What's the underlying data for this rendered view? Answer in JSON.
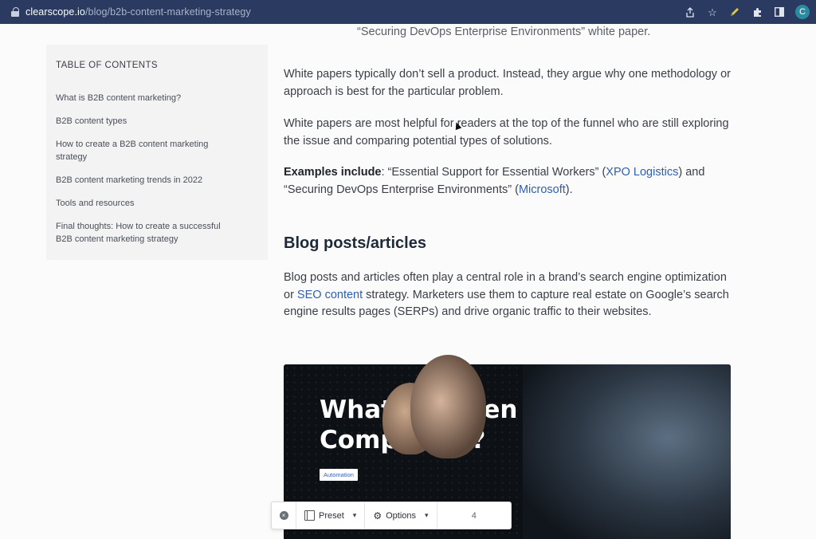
{
  "browser": {
    "url_host": "clearscope.io",
    "url_path": "/blog/b2b-content-marketing-strategy",
    "avatar_letter": "C"
  },
  "toc": {
    "title": "TABLE OF CONTENTS",
    "items": [
      "What is B2B content marketing?",
      "B2B content types",
      "How to create a B2B content marketing strategy",
      "B2B content marketing trends in 2022",
      "Tools and resources",
      "Final thoughts: How to create a successful B2B content marketing strategy"
    ]
  },
  "article": {
    "top_line": "“Securing DevOps Enterprise Environments” white paper.",
    "p1": "White papers typically don’t sell a product. Instead, they argue why one methodology or approach is best for the particular problem.",
    "p2": "White papers are most helpful for readers at the top of the funnel who are still exploring the issue and comparing potential types of solutions.",
    "p3": {
      "bold": "Examples include",
      "t1": ": “Essential Support for Essential Workers” (",
      "link1": "XPO Logistics",
      "t2": ") and “Securing DevOps Enterprise Environments” (",
      "link2": "Microsoft",
      "t3": ")."
    },
    "heading": "Blog posts/articles",
    "p4": {
      "t1": "Blog posts and articles often play a central role in a brand’s search engine optimization or ",
      "link": "SEO content",
      "t2": " strategy. Marketers use them to capture real estate on Google’s search engine results pages (SERPs) and drive organic traffic to their websites."
    },
    "image": {
      "title": "What Is Green Computing?",
      "tag": "Automation"
    }
  },
  "toolbar": {
    "preset_label": "Preset",
    "options_label": "Options",
    "number": "4"
  }
}
